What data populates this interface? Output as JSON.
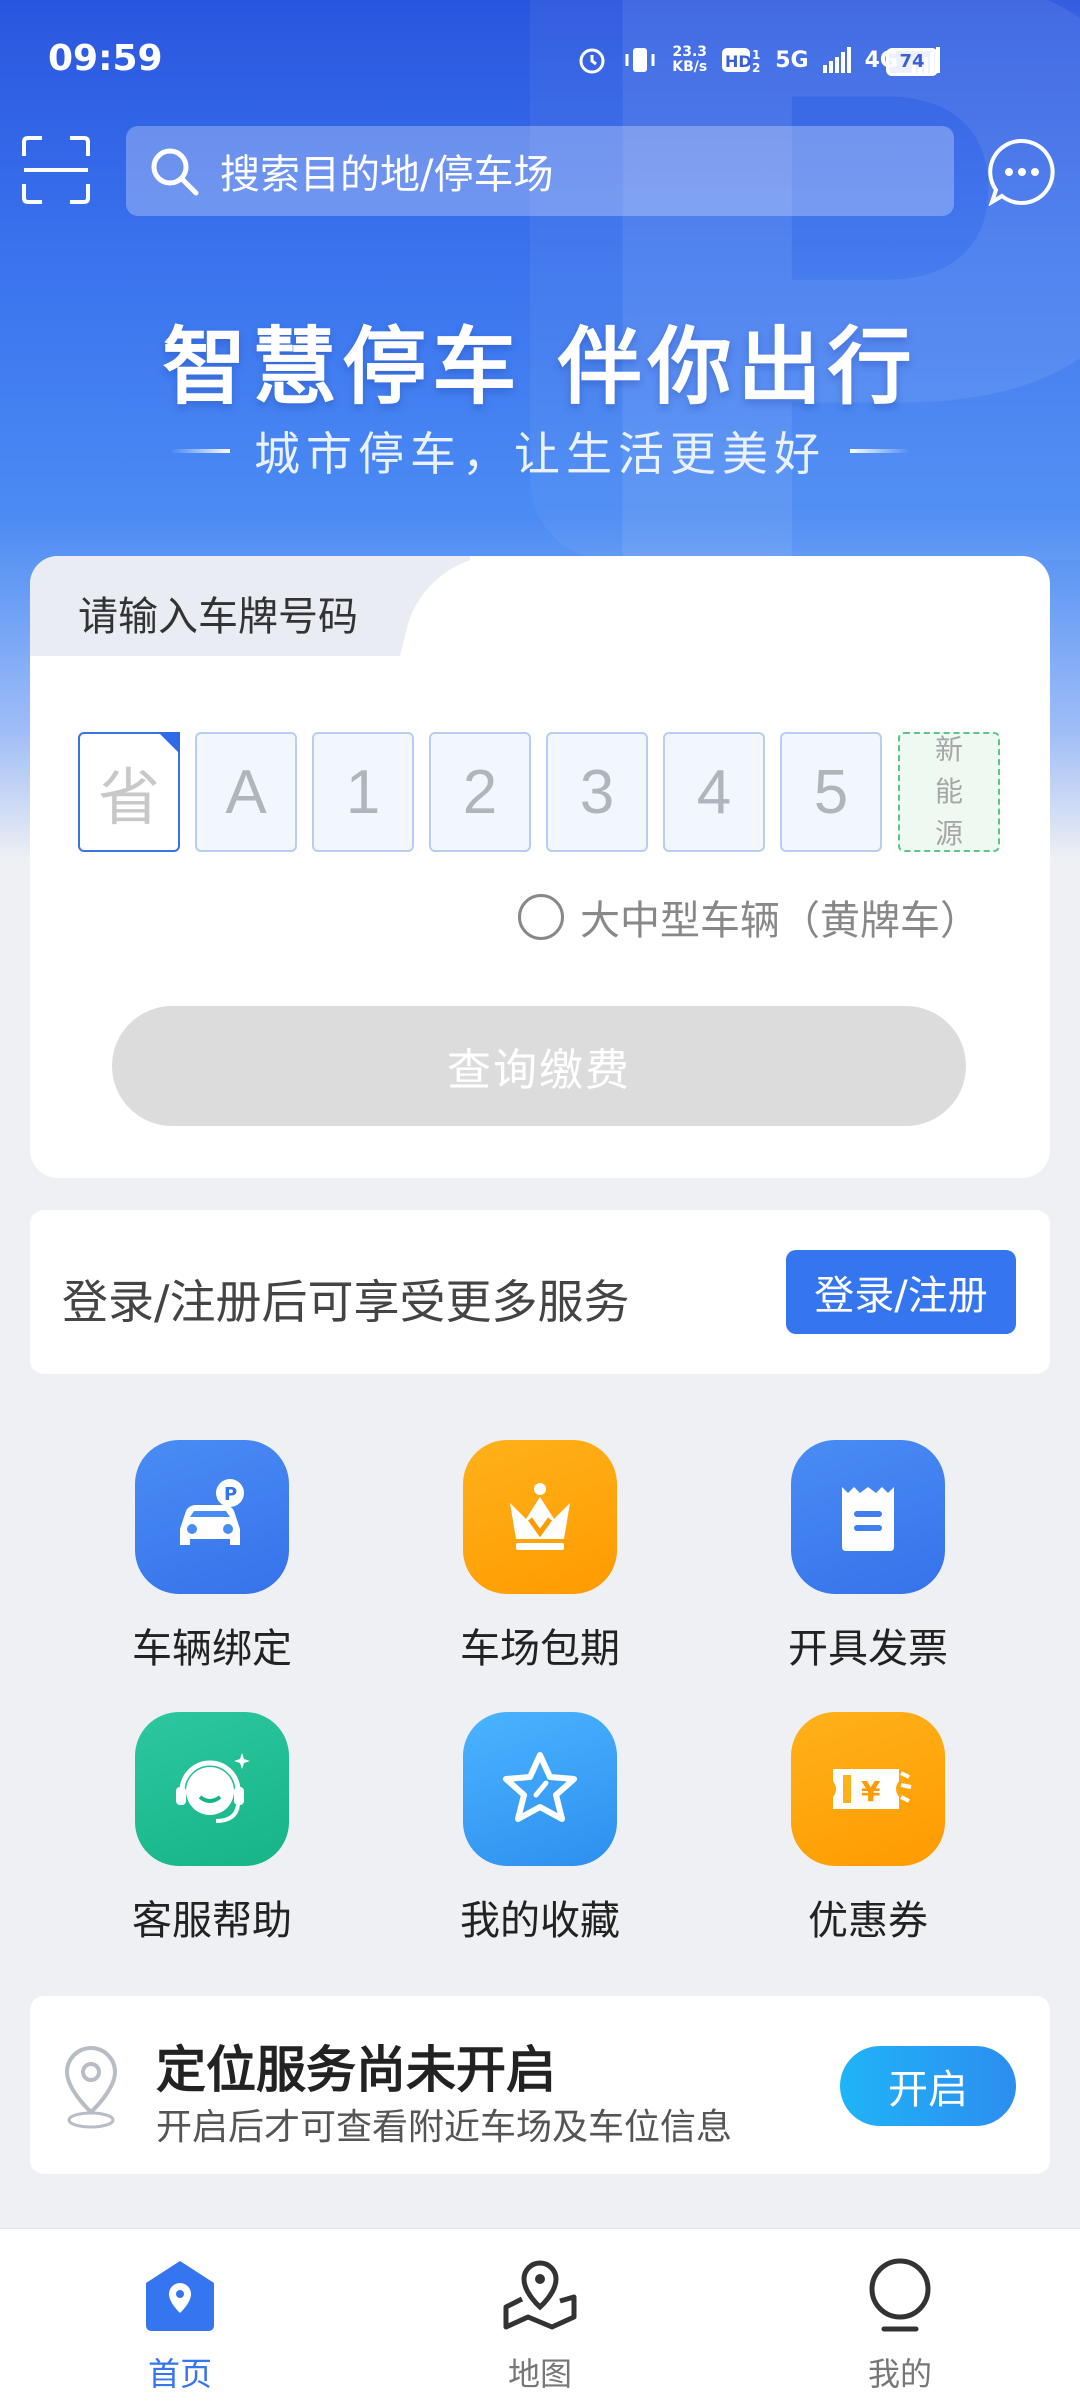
{
  "status_bar": {
    "time": "09:59",
    "net_speed_top": "23.3",
    "net_speed_unit": "KB/s",
    "signal_a": "5G",
    "signal_b": "4G",
    "battery": "74"
  },
  "top_bar": {
    "search_placeholder": "搜索目的地/停车场"
  },
  "hero": {
    "title": "智慧停车 伴你出行",
    "subtitle": "城市停车，让生活更美好"
  },
  "plate_card": {
    "tab_label": "请输入车牌号码",
    "cells": [
      "省",
      "A",
      "1",
      "2",
      "3",
      "4",
      "5"
    ],
    "new_energy_chars": [
      "新",
      "能",
      "源"
    ],
    "yellow_plate_label": "大中型车辆（黄牌车）",
    "query_button": "查询缴费"
  },
  "login_card": {
    "text": "登录/注册后可享受更多服务",
    "button": "登录/注册"
  },
  "services": [
    {
      "label": "车辆绑定",
      "icon": "car-parking-icon",
      "color": "#3f7ff0"
    },
    {
      "label": "车场包期",
      "icon": "crown-icon",
      "color": "#ffa60d"
    },
    {
      "label": "开具发票",
      "icon": "invoice-icon",
      "color": "#3f7ff0"
    },
    {
      "label": "客服帮助",
      "icon": "headset-icon",
      "color": "#1fbd93"
    },
    {
      "label": "我的收藏",
      "icon": "star-icon",
      "color": "#3ca2fa"
    },
    {
      "label": "优惠券",
      "icon": "coupon-icon",
      "color": "#ffa60d"
    }
  ],
  "location_card": {
    "title": "定位服务尚未开启",
    "description": "开启后才可查看附近车场及车位信息",
    "button": "开启"
  },
  "bottom_nav": {
    "items": [
      {
        "label": "首页",
        "icon": "home-icon",
        "active": true
      },
      {
        "label": "地图",
        "icon": "map-icon",
        "active": false
      },
      {
        "label": "我的",
        "icon": "profile-icon",
        "active": false
      }
    ]
  },
  "colors": {
    "primary": "#3575f0",
    "hero_top": "#2a56df",
    "background": "#eef0f4"
  }
}
